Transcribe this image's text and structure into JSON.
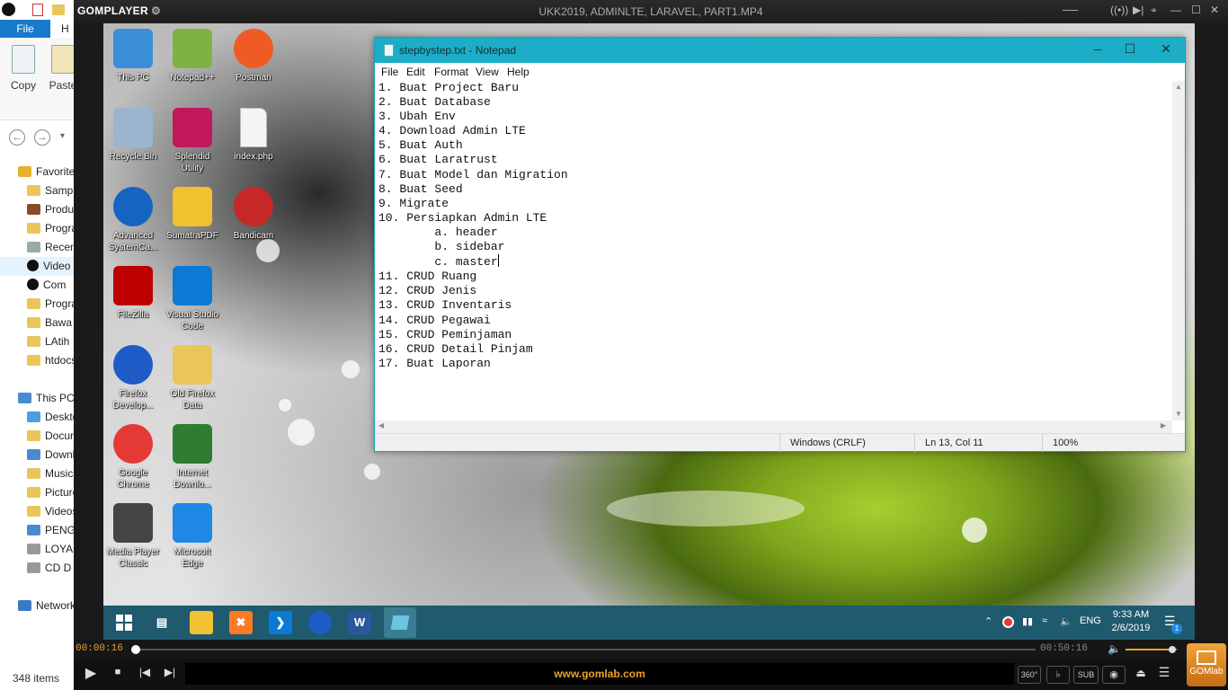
{
  "explorer": {
    "file_tab": "File",
    "home_tab": "H",
    "ribbon": {
      "copy_label": "Copy",
      "paste_label": "Paste"
    },
    "tree": [
      {
        "label": "Favorites",
        "icon": "star-icon",
        "color": "#e8b12a"
      },
      {
        "label": "Sample",
        "icon": "folder-icon",
        "color": "#e9c55a"
      },
      {
        "label": "Products",
        "icon": "folder-icon",
        "color": "#8a4b28"
      },
      {
        "label": "Program",
        "icon": "folder-icon",
        "color": "#e9c55a"
      },
      {
        "label": "Recent",
        "icon": "recent-icon",
        "color": "#9aa"
      },
      {
        "label": "Video",
        "icon": "gom-icon",
        "color": "#111"
      },
      {
        "label": "Com",
        "icon": "gom-icon",
        "color": "#111"
      },
      {
        "label": "Program",
        "icon": "folder-icon",
        "color": "#e9c55a"
      },
      {
        "label": "Bawa",
        "icon": "folder-icon",
        "color": "#e9c55a"
      },
      {
        "label": "LAtih",
        "icon": "folder-icon",
        "color": "#e9c55a"
      },
      {
        "label": "htdocs",
        "icon": "folder-icon",
        "color": "#e9c55a"
      },
      {
        "label": "This PC",
        "icon": "computer-icon",
        "color": "#4a8ad0"
      },
      {
        "label": "Desktop",
        "icon": "folder-icon",
        "color": "#4aa0e0"
      },
      {
        "label": "Documents",
        "icon": "folder-icon",
        "color": "#e9c55a"
      },
      {
        "label": "Downloads",
        "icon": "folder-icon",
        "color": "#4a8ad0"
      },
      {
        "label": "Music",
        "icon": "folder-icon",
        "color": "#e9c55a"
      },
      {
        "label": "Pictures",
        "icon": "folder-icon",
        "color": "#e9c55a"
      },
      {
        "label": "Videos",
        "icon": "folder-icon",
        "color": "#e9c55a"
      },
      {
        "label": "PENG",
        "icon": "drive-icon",
        "color": "#4a8ad0"
      },
      {
        "label": "LOYA",
        "icon": "drive-icon",
        "color": "#999"
      },
      {
        "label": "CD D",
        "icon": "cd-drive-icon",
        "color": "#999"
      },
      {
        "label": "Network",
        "icon": "network-icon",
        "color": "#3a7ac0"
      }
    ],
    "items_count": "348 items"
  },
  "gom": {
    "logo": "GOMPLAYER",
    "title": "UKK2019, ADMINLTE, LARAVEL, PART1.MP4",
    "elapsed": "00:00:16",
    "total": "00:50:16",
    "progress": 0.0053,
    "volume": 0.9,
    "url": "www.gomlab.com",
    "buttons": {
      "360": "360°",
      "sub": "SUB"
    },
    "brand_label": "GOMlab",
    "accent": "#e8a22f"
  },
  "desktop": {
    "icons": [
      {
        "label": "This PC",
        "icon": "this-pc-icon",
        "color": "#3b8fd9"
      },
      {
        "label": "Notepad++",
        "icon": "notepad-plus-plus-icon",
        "color": "#7cb342"
      },
      {
        "label": "Postman",
        "icon": "postman-icon",
        "color": "#ef5b25"
      },
      {
        "label": "Recycle Bin",
        "icon": "recycle-bin-icon",
        "color": "#9bb5cf"
      },
      {
        "label": "Splendid Utility",
        "icon": "splendid-utility-icon",
        "color": "#c2185b"
      },
      {
        "label": "index.php",
        "icon": "file-icon",
        "color": "#f5f5f5"
      },
      {
        "label": "Advanced SystemCa...",
        "icon": "advanced-systemcare-icon",
        "color": "#1565c0"
      },
      {
        "label": "SumatraPDF",
        "icon": "sumatra-pdf-icon",
        "color": "#f2c12e"
      },
      {
        "label": "Bandicam",
        "icon": "bandicam-icon",
        "color": "#c62828"
      },
      {
        "label": "FileZilla",
        "icon": "filezilla-icon",
        "color": "#bf0000"
      },
      {
        "label": "Visual Studio Code",
        "icon": "vscode-icon",
        "color": "#0a7ad4"
      },
      {
        "label": "Firefox Develop...",
        "icon": "firefox-developer-icon",
        "color": "#1e5bc6"
      },
      {
        "label": "Old Firefox Data",
        "icon": "folder-icon",
        "color": "#e9c55a"
      },
      {
        "label": "Google Chrome",
        "icon": "chrome-icon",
        "color": "#e53935"
      },
      {
        "label": "Internet Downlo...",
        "icon": "internet-download-manager-icon",
        "color": "#2e7d32"
      },
      {
        "label": "Media Player Classic",
        "icon": "media-player-classic-icon",
        "color": "#444"
      },
      {
        "label": "Microsoft Edge",
        "icon": "edge-icon",
        "color": "#1e88e5"
      }
    ]
  },
  "notepad": {
    "title": "stepbystep.txt - Notepad",
    "menu": [
      "File",
      "Edit",
      "Format",
      "View",
      "Help"
    ],
    "lines": [
      "1. Buat Project Baru",
      "2. Buat Database",
      "3. Ubah Env",
      "4. Download Admin LTE",
      "5. Buat Auth",
      "6. Buat Laratrust",
      "7. Buat Model dan Migration",
      "8. Buat Seed",
      "9. Migrate",
      "10. Persiapkan Admin LTE",
      "        a. header",
      "        b. sidebar",
      "        c. master",
      "11. CRUD Ruang",
      "12. CRUD Jenis",
      "13. CRUD Inventaris",
      "14. CRUD Pegawai",
      "15. CRUD Peminjaman",
      "16. CRUD Detail Pinjam",
      "17. Buat Laporan"
    ],
    "status": {
      "encoding": "Windows (CRLF)",
      "position": "Ln 13, Col 11",
      "zoom": "100%"
    }
  },
  "taskbar": {
    "apps": [
      {
        "icon": "windows-start-icon",
        "color": "transparent"
      },
      {
        "icon": "task-view-icon",
        "color": "transparent"
      },
      {
        "icon": "file-explorer-icon",
        "color": "#f1c232"
      },
      {
        "icon": "xampp-icon",
        "color": "#fb7a24"
      },
      {
        "icon": "vscode-icon",
        "color": "#0a7ad4"
      },
      {
        "icon": "firefox-icon",
        "color": "#1e5bc6"
      },
      {
        "icon": "word-icon",
        "color": "#2b579a"
      },
      {
        "icon": "notepad-icon",
        "color": "#6cc4e0"
      }
    ],
    "lang": "ENG",
    "time": "9:33 AM",
    "date": "2/6/2019",
    "notifications": "1"
  }
}
